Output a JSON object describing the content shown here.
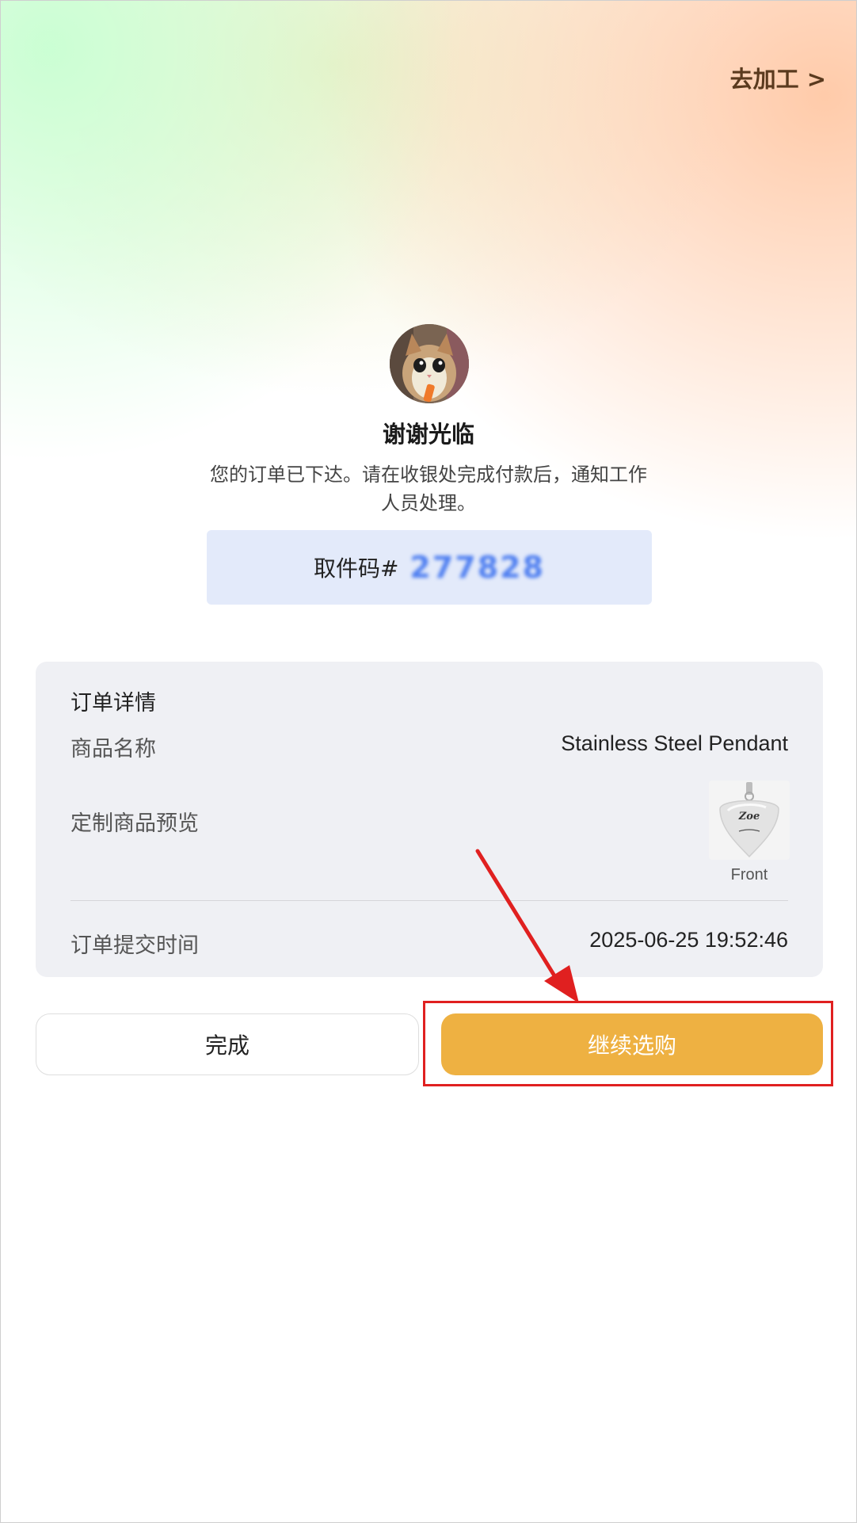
{
  "header": {
    "process_link": "去加工 >"
  },
  "confirmation": {
    "title": "谢谢光临",
    "message": "您的订单已下达。请在收银处完成付款后，通知工作人员处理。",
    "pickup_label": "取件码#",
    "pickup_code": "277828"
  },
  "order_details": {
    "title": "订单详情",
    "product_name_label": "商品名称",
    "product_name_value": "Stainless Steel Pendant",
    "preview_label": "定制商品预览",
    "preview_caption": "Front",
    "preview_engraving": "Zoe",
    "submit_time_label": "订单提交时间",
    "submit_time_value": "2025-06-25 19:52:46"
  },
  "actions": {
    "done_label": "完成",
    "continue_label": "继续选购"
  },
  "colors": {
    "accent": "#eeb142",
    "pickup_bg": "#e3eafa",
    "pickup_code": "#4f7ff0",
    "annotation": "#e02020"
  },
  "icons": {
    "process_link": "chevron-right-icon",
    "annotation": "red-arrow-annotation"
  }
}
